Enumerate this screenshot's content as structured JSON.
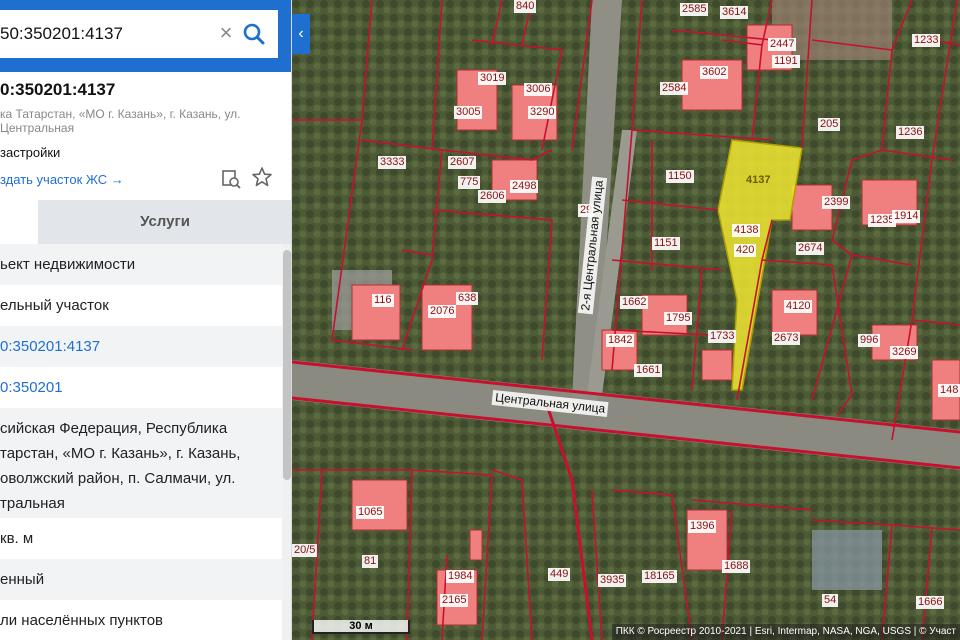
{
  "search": {
    "value": "50:350201:4137",
    "clear_glyph": "×",
    "collapse_glyph": "‹"
  },
  "object": {
    "title": "0:350201:4137",
    "address_short": "ка Татарстан, «МО г. Казань», г. Казань, ул. Центральная",
    "zone": "застройки",
    "create_link": "здать участок ЖС →"
  },
  "tabs": {
    "services": "Услуги"
  },
  "rows": [
    {
      "text": "ьект недвижимости"
    },
    {
      "text": "ельный участок"
    },
    {
      "text": "0:350201:4137"
    },
    {
      "text": "0:350201"
    },
    {
      "text": "сийская Федерация, Республика тарстан, «МО г. Казань», г. Казань, оволжский район, п. Салмачи, ул. тральная"
    },
    {
      "text": "кв. м"
    },
    {
      "text": "енный"
    },
    {
      "text": "ли населённых пунктов"
    }
  ],
  "map": {
    "streets": {
      "central": "Центральная улица",
      "second_central": "2-я Центральная улица"
    },
    "parcels": [
      "4137",
      "1150",
      "1151",
      "4138",
      "420",
      "2674",
      "2399",
      "3333",
      "2607",
      "775",
      "2606",
      "2498",
      "3005",
      "3019",
      "3006",
      "3290",
      "2584",
      "3602",
      "2447",
      "1191",
      "2585",
      "3614",
      "840",
      "205",
      "1233",
      "1236",
      "1235",
      "1914",
      "116",
      "2076",
      "638",
      "1662",
      "1795",
      "1842",
      "1733",
      "1661",
      "4120",
      "2673",
      "996",
      "3269",
      "148",
      "29",
      "1065",
      "81",
      "1984",
      "2165",
      "449",
      "3935",
      "18165",
      "1396",
      "1688",
      "54",
      "1666",
      "20/5"
    ],
    "scale": "30 м",
    "attribution": "ПКК © Росреестр 2010-2021 | Esri, Intermap, NASA, NGA, USGS | © Участ",
    "colors": {
      "boundary": "#c8102e",
      "selected_fill": "#f0e630",
      "building": "#f08080"
    }
  },
  "icons": [
    "search-icon",
    "close-icon",
    "chevron-left-icon",
    "copy-search-icon",
    "star-icon"
  ]
}
